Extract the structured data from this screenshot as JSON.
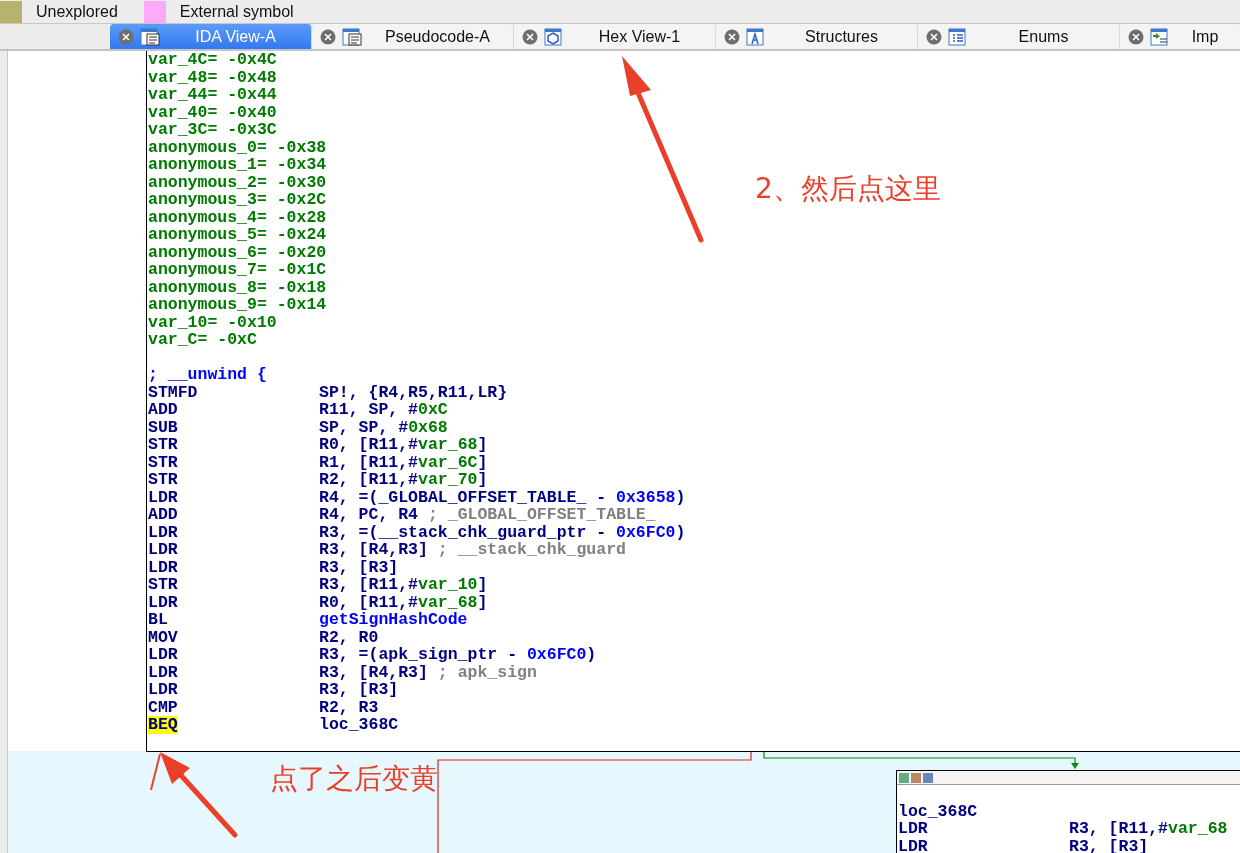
{
  "legend": [
    {
      "label": "Unexplored",
      "color": "#b8b36c"
    },
    {
      "label": "External symbol",
      "color": "#ffa9f9"
    }
  ],
  "tabs": [
    {
      "label": "IDA View-A",
      "selected": true,
      "kind": "disasm"
    },
    {
      "label": "Pseudocode-A",
      "selected": false,
      "kind": "disasm"
    },
    {
      "label": "Hex View-1",
      "selected": false,
      "kind": "hex"
    },
    {
      "label": "Structures",
      "selected": false,
      "kind": "struct"
    },
    {
      "label": "Enums",
      "selected": false,
      "kind": "enum"
    },
    {
      "label": "Imp",
      "selected": false,
      "kind": "import"
    }
  ],
  "main_node": {
    "lines": [
      {
        "kind": "var",
        "text": "var_4C= -0x4C"
      },
      {
        "kind": "var",
        "text": "var_48= -0x48"
      },
      {
        "kind": "var",
        "text": "var_44= -0x44"
      },
      {
        "kind": "var",
        "text": "var_40= -0x40"
      },
      {
        "kind": "var",
        "text": "var_3C= -0x3C"
      },
      {
        "kind": "var",
        "text": "anonymous_0= -0x38"
      },
      {
        "kind": "var",
        "text": "anonymous_1= -0x34"
      },
      {
        "kind": "var",
        "text": "anonymous_2= -0x30"
      },
      {
        "kind": "var",
        "text": "anonymous_3= -0x2C"
      },
      {
        "kind": "var",
        "text": "anonymous_4= -0x28"
      },
      {
        "kind": "var",
        "text": "anonymous_5= -0x24"
      },
      {
        "kind": "var",
        "text": "anonymous_6= -0x20"
      },
      {
        "kind": "var",
        "text": "anonymous_7= -0x1C"
      },
      {
        "kind": "var",
        "text": "anonymous_8= -0x18"
      },
      {
        "kind": "var",
        "text": "anonymous_9= -0x14"
      },
      {
        "kind": "var",
        "text": "var_10= -0x10"
      },
      {
        "kind": "var",
        "text": "var_C= -0xC"
      },
      {
        "kind": "blank"
      },
      {
        "kind": "comment",
        "text": "; __unwind {"
      },
      {
        "kind": "insn",
        "mnemonic": "STMFD",
        "highlighted": false,
        "operands": [
          {
            "kind": "reg",
            "text": "SP!, {R4,R5,R11,LR}"
          }
        ]
      },
      {
        "kind": "insn",
        "mnemonic": "ADD",
        "highlighted": false,
        "operands": [
          {
            "kind": "reg",
            "text": "R11, SP, #"
          },
          {
            "kind": "var",
            "text": "0xC"
          }
        ]
      },
      {
        "kind": "insn",
        "mnemonic": "SUB",
        "highlighted": false,
        "operands": [
          {
            "kind": "reg",
            "text": "SP, SP, #"
          },
          {
            "kind": "var",
            "text": "0x68"
          }
        ]
      },
      {
        "kind": "insn",
        "mnemonic": "STR",
        "highlighted": false,
        "operands": [
          {
            "kind": "reg",
            "text": "R0, [R11,#"
          },
          {
            "kind": "var",
            "text": "var_68"
          },
          {
            "kind": "reg",
            "text": "]"
          }
        ]
      },
      {
        "kind": "insn",
        "mnemonic": "STR",
        "highlighted": false,
        "operands": [
          {
            "kind": "reg",
            "text": "R1, [R11,#"
          },
          {
            "kind": "var",
            "text": "var_6C"
          },
          {
            "kind": "reg",
            "text": "]"
          }
        ]
      },
      {
        "kind": "insn",
        "mnemonic": "STR",
        "highlighted": false,
        "operands": [
          {
            "kind": "reg",
            "text": "R2, [R11,#"
          },
          {
            "kind": "var",
            "text": "var_70"
          },
          {
            "kind": "reg",
            "text": "]"
          }
        ]
      },
      {
        "kind": "insn",
        "mnemonic": "LDR",
        "highlighted": false,
        "operands": [
          {
            "kind": "reg",
            "text": "R4, =(_GLOBAL_OFFSET_TABLE_ - "
          },
          {
            "kind": "num",
            "text": "0x3658"
          },
          {
            "kind": "reg",
            "text": ")"
          }
        ]
      },
      {
        "kind": "insn",
        "mnemonic": "ADD",
        "highlighted": false,
        "operands": [
          {
            "kind": "reg",
            "text": "R4, PC, R4 "
          },
          {
            "kind": "cmt",
            "text": "; _GLOBAL_OFFSET_TABLE_"
          }
        ]
      },
      {
        "kind": "insn",
        "mnemonic": "LDR",
        "highlighted": false,
        "operands": [
          {
            "kind": "reg",
            "text": "R3, =(__stack_chk_guard_ptr - "
          },
          {
            "kind": "num",
            "text": "0x6FC0"
          },
          {
            "kind": "reg",
            "text": ")"
          }
        ]
      },
      {
        "kind": "insn",
        "mnemonic": "LDR",
        "highlighted": false,
        "operands": [
          {
            "kind": "reg",
            "text": "R3, [R4,R3] "
          },
          {
            "kind": "cmt",
            "text": "; __stack_chk_guard"
          }
        ]
      },
      {
        "kind": "insn",
        "mnemonic": "LDR",
        "highlighted": false,
        "operands": [
          {
            "kind": "reg",
            "text": "R3, [R3]"
          }
        ]
      },
      {
        "kind": "insn",
        "mnemonic": "STR",
        "highlighted": false,
        "operands": [
          {
            "kind": "reg",
            "text": "R3, [R11,#"
          },
          {
            "kind": "var",
            "text": "var_10"
          },
          {
            "kind": "reg",
            "text": "]"
          }
        ]
      },
      {
        "kind": "insn",
        "mnemonic": "LDR",
        "highlighted": false,
        "operands": [
          {
            "kind": "reg",
            "text": "R0, [R11,#"
          },
          {
            "kind": "var",
            "text": "var_68"
          },
          {
            "kind": "reg",
            "text": "]"
          }
        ]
      },
      {
        "kind": "insn",
        "mnemonic": "BL",
        "highlighted": false,
        "operands": [
          {
            "kind": "num",
            "text": "getSignHashCode"
          }
        ]
      },
      {
        "kind": "insn",
        "mnemonic": "MOV",
        "highlighted": false,
        "operands": [
          {
            "kind": "reg",
            "text": "R2, R0"
          }
        ]
      },
      {
        "kind": "insn",
        "mnemonic": "LDR",
        "highlighted": false,
        "operands": [
          {
            "kind": "reg",
            "text": "R3, =(apk_sign_ptr - "
          },
          {
            "kind": "num",
            "text": "0x6FC0"
          },
          {
            "kind": "reg",
            "text": ")"
          }
        ]
      },
      {
        "kind": "insn",
        "mnemonic": "LDR",
        "highlighted": false,
        "operands": [
          {
            "kind": "reg",
            "text": "R3, [R4,R3] "
          },
          {
            "kind": "cmt",
            "text": "; apk_sign"
          }
        ]
      },
      {
        "kind": "insn",
        "mnemonic": "LDR",
        "highlighted": false,
        "operands": [
          {
            "kind": "reg",
            "text": "R3, [R3]"
          }
        ]
      },
      {
        "kind": "insn",
        "mnemonic": "CMP",
        "highlighted": false,
        "operands": [
          {
            "kind": "reg",
            "text": "R2, R3"
          }
        ]
      },
      {
        "kind": "insn",
        "mnemonic": "BEQ",
        "highlighted": true,
        "operands": [
          {
            "kind": "reg",
            "text": "loc_368C"
          }
        ]
      }
    ]
  },
  "target_node": {
    "lines": [
      {
        "kind": "blank"
      },
      {
        "kind": "label",
        "text": "loc_368C"
      },
      {
        "kind": "insn",
        "mnemonic": "LDR",
        "highlighted": false,
        "operands": [
          {
            "kind": "reg",
            "text": "R3, [R11,#"
          },
          {
            "kind": "var",
            "text": "var_68"
          }
        ]
      },
      {
        "kind": "insn",
        "mnemonic": "LDR",
        "highlighted": false,
        "operands": [
          {
            "kind": "reg",
            "text": "R3, [R3]"
          }
        ]
      }
    ]
  },
  "annotations": [
    {
      "text": "2、然后点这里"
    },
    {
      "text": "点了之后变黄"
    }
  ]
}
